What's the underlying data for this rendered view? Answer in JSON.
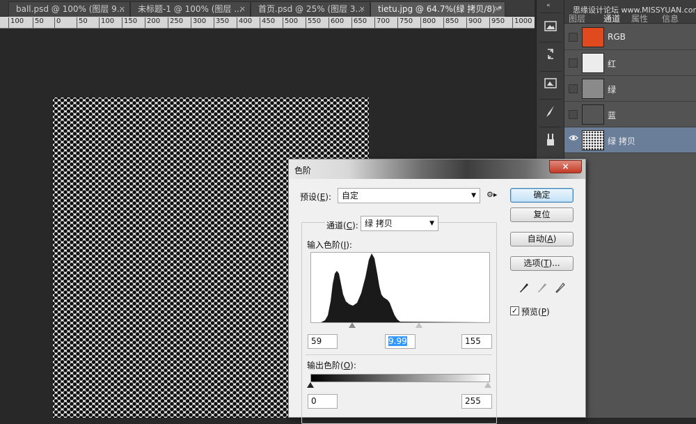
{
  "tabs": [
    {
      "label": "ball.psd @ 100% (图层 9...",
      "close": "×"
    },
    {
      "label": "未标题-1 @ 100% (图层 ...",
      "close": "×"
    },
    {
      "label": "首页.psd @ 25% (图层 3...",
      "close": "×"
    },
    {
      "label": "tietu.jpg @ 64.7%(绿 拷贝/8) *",
      "close": "×"
    }
  ],
  "ruler": [
    "100",
    "50",
    "0",
    "50",
    "100",
    "150",
    "200",
    "250",
    "300",
    "350",
    "400",
    "450",
    "500",
    "550",
    "600",
    "650",
    "700",
    "750",
    "800",
    "850",
    "900",
    "950",
    "1000"
  ],
  "panel": {
    "collapse_icon": "«",
    "watermark": "思缘设计论坛 www.MISSYUAN.com",
    "tabs": [
      "图层",
      "通道",
      "属性",
      "信息"
    ],
    "active_tab": "通道",
    "channels": [
      {
        "name": "RGB",
        "color": "#e04a1e",
        "visible": false
      },
      {
        "name": "红",
        "color": "#ececec",
        "visible": false
      },
      {
        "name": "绿",
        "color": "#8a8a8a",
        "visible": false
      },
      {
        "name": "蓝",
        "color": "#555555",
        "visible": false
      },
      {
        "name": "绿 拷贝",
        "color": "#f2f2f2",
        "visible": true,
        "selected": true
      }
    ]
  },
  "dialog": {
    "title": "色阶",
    "close": "×",
    "preset_label_pre": "预设(",
    "preset_key": "E",
    "preset_label_post": "):",
    "preset_value": "自定",
    "preset_arrow": "▼",
    "gear": "⚙▸",
    "channel_label_pre": "通道(",
    "channel_key": "C",
    "channel_label_post": "):",
    "channel_value": "绿 拷贝",
    "input_label_pre": "输入色阶(",
    "input_key": "I",
    "input_label_post": "):",
    "input_values": {
      "black": "59",
      "gamma": "9.99",
      "white": "155"
    },
    "output_label_pre": "输出色阶(",
    "output_key": "O",
    "output_label_post": "):",
    "output_values": {
      "black": "0",
      "white": "255"
    },
    "buttons": {
      "ok": "确定",
      "reset": "复位",
      "auto_pre": "自动(",
      "auto_key": "A",
      "auto_post": ")",
      "options_pre": "选项(",
      "options_key": "T",
      "options_post": ")..."
    },
    "preview_label_pre": "预览(",
    "preview_key": "P",
    "preview_label_post": ")",
    "preview_checked": "✓"
  }
}
